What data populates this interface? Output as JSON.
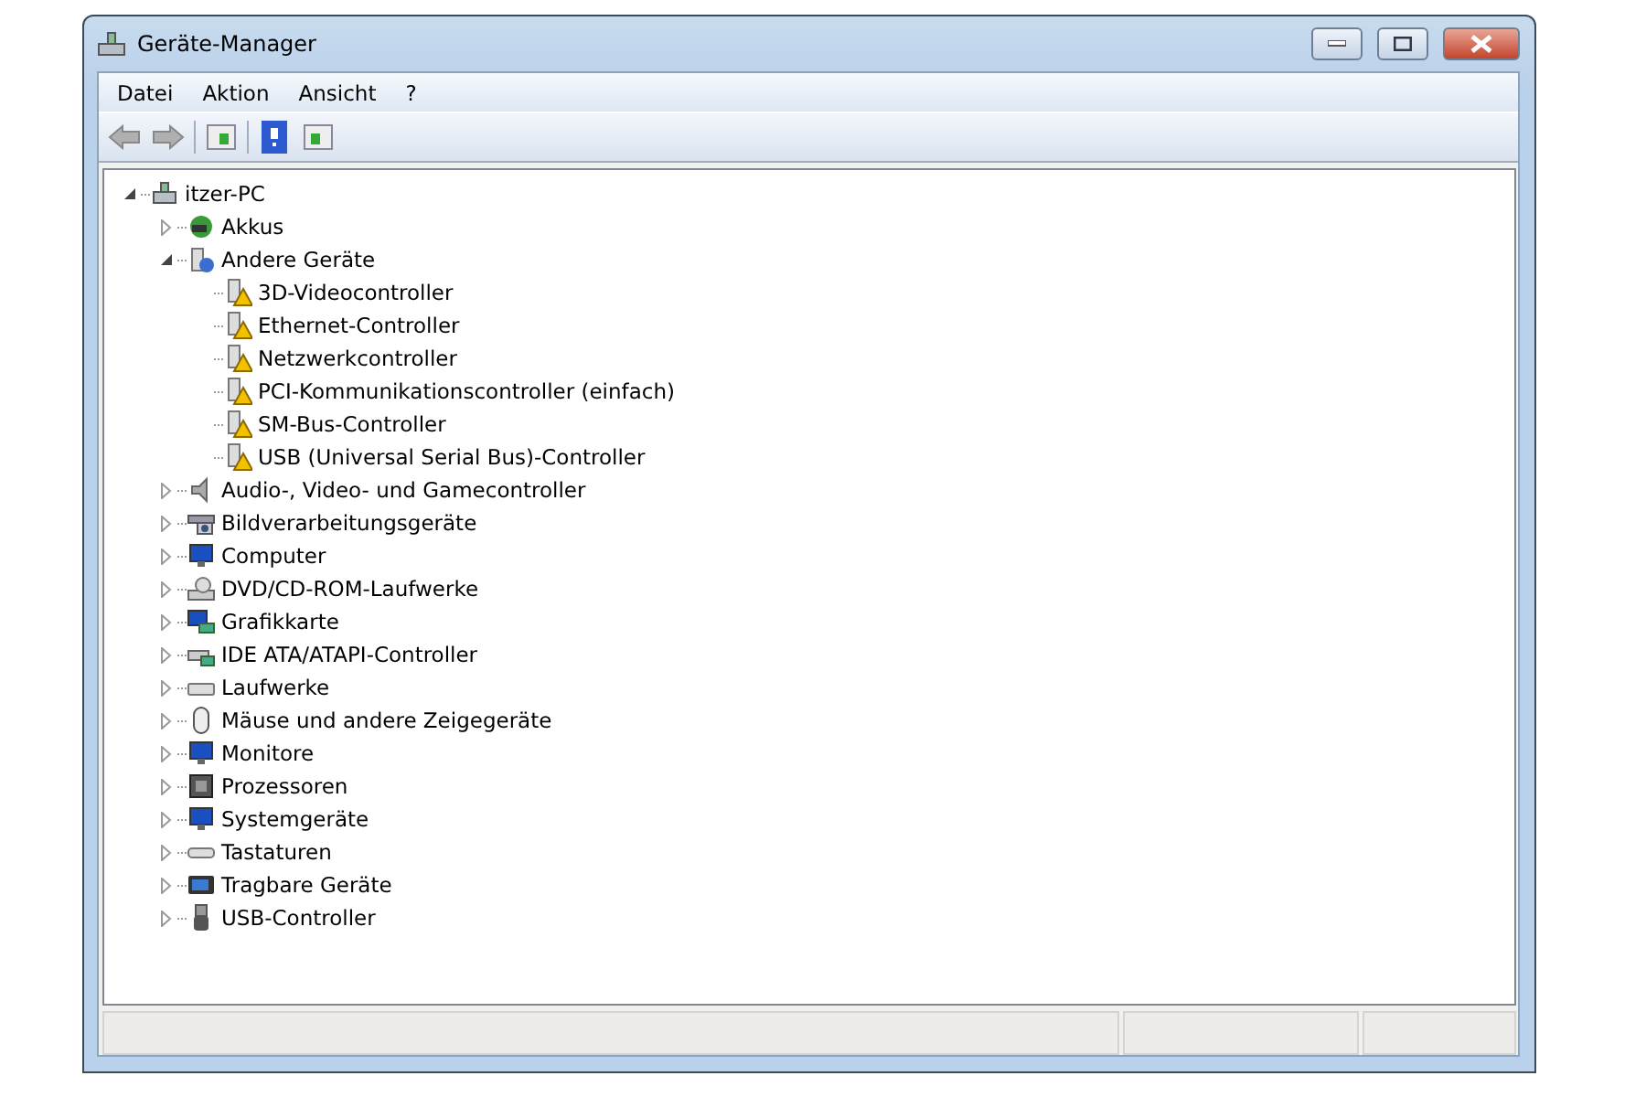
{
  "window": {
    "title": "Geräte-Manager"
  },
  "menu": [
    {
      "label": "Datei"
    },
    {
      "label": "Aktion"
    },
    {
      "label": "Ansicht"
    },
    {
      "label": "?"
    }
  ],
  "toolbar": [
    {
      "kind": "back"
    },
    {
      "kind": "forward"
    },
    {
      "kind": "separator"
    },
    {
      "kind": "panel"
    },
    {
      "kind": "separator"
    },
    {
      "kind": "help"
    },
    {
      "kind": "panel2"
    }
  ],
  "tree": [
    {
      "label": "itzer-PC",
      "kind": "computer",
      "expanded": true,
      "children": [
        {
          "label": "Akkus",
          "kind": "battery",
          "expanded": false
        },
        {
          "label": "Andere Geräte",
          "kind": "unknown",
          "expanded": true,
          "children": [
            {
              "label": "3D-Videocontroller",
              "kind": "warning"
            },
            {
              "label": "Ethernet-Controller",
              "kind": "warning"
            },
            {
              "label": "Netzwerkcontroller",
              "kind": "warning"
            },
            {
              "label": "PCI-Kommunikationscontroller (einfach)",
              "kind": "warning"
            },
            {
              "label": "SM-Bus-Controller",
              "kind": "warning"
            },
            {
              "label": "USB (Universal Serial Bus)-Controller",
              "kind": "warning"
            }
          ]
        },
        {
          "label": "Audio-, Video- und Gamecontroller",
          "kind": "speaker",
          "expanded": false
        },
        {
          "label": "Bildverarbeitungsgeräte",
          "kind": "camera",
          "expanded": false
        },
        {
          "label": "Computer",
          "kind": "monitor",
          "expanded": false
        },
        {
          "label": "DVD/CD-ROM-Laufwerke",
          "kind": "disc",
          "expanded": false
        },
        {
          "label": "Grafikkarte",
          "kind": "card",
          "expanded": false
        },
        {
          "label": "IDE ATA/ATAPI-Controller",
          "kind": "controller",
          "expanded": false
        },
        {
          "label": "Laufwerke",
          "kind": "drive",
          "expanded": false
        },
        {
          "label": "Mäuse und andere Zeigegeräte",
          "kind": "mouse",
          "expanded": false
        },
        {
          "label": "Monitore",
          "kind": "monitor",
          "expanded": false
        },
        {
          "label": "Prozessoren",
          "kind": "chip",
          "expanded": false
        },
        {
          "label": "Systemgeräte",
          "kind": "monitor",
          "expanded": false
        },
        {
          "label": "Tastaturen",
          "kind": "keyboard",
          "expanded": false
        },
        {
          "label": "Tragbare Geräte",
          "kind": "portable",
          "expanded": false
        },
        {
          "label": "USB-Controller",
          "kind": "usb",
          "expanded": false
        }
      ]
    }
  ]
}
